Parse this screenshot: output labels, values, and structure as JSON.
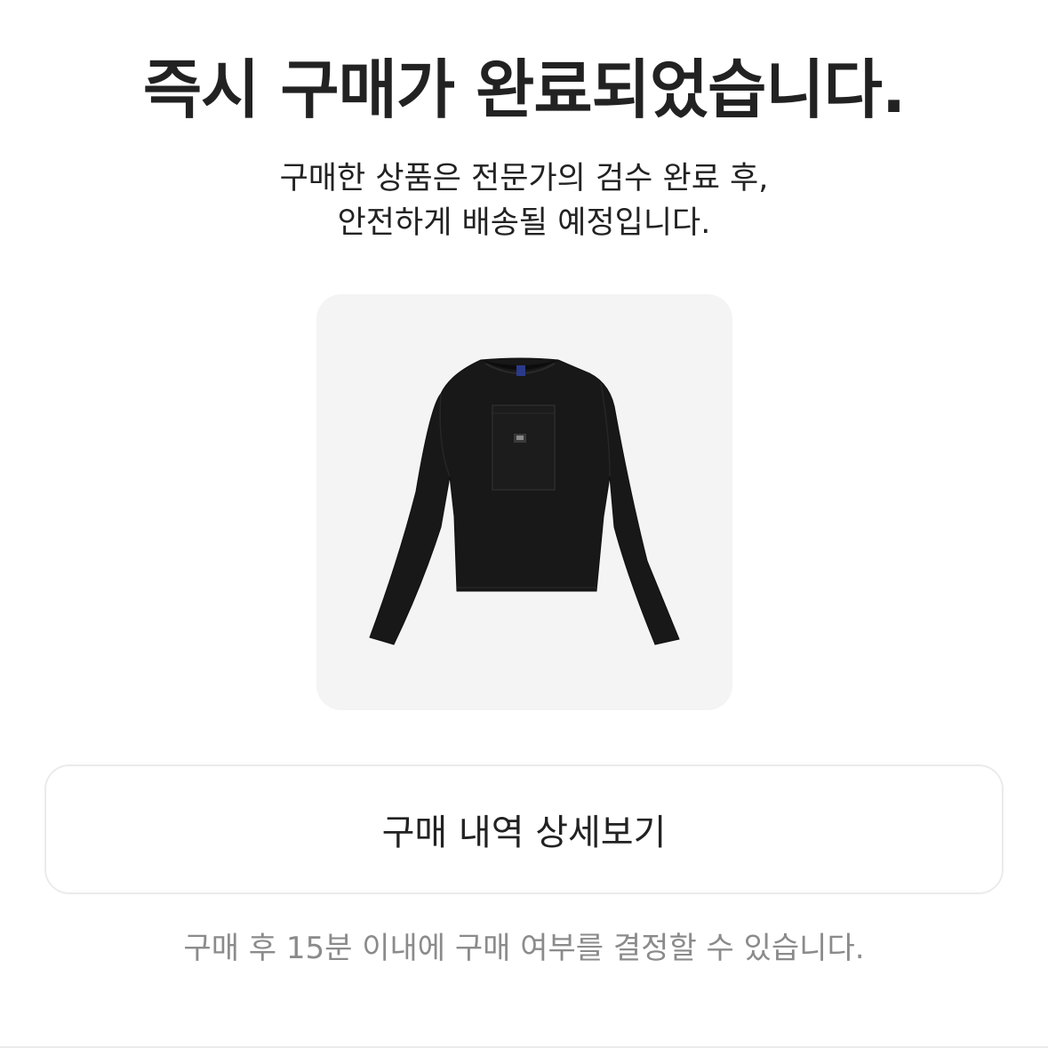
{
  "header": {
    "title": "즉시 구매가 완료되었습니다.",
    "subtitle_line1": "구매한 상품은 전문가의 검수 완료 후,",
    "subtitle_line2": "안전하게 배송될 예정입니다."
  },
  "product": {
    "image_icon": "black-long-sleeve-shirt-image",
    "image_background": "#f4f4f4"
  },
  "actions": {
    "detail_button_label": "구매 내역 상세보기"
  },
  "footer": {
    "notice": "구매 후 15분 이내에 구매 여부를 결정할 수 있습니다."
  },
  "colors": {
    "text_primary": "#222222",
    "text_secondary": "#8b8b8b",
    "border": "#ebebeb"
  }
}
